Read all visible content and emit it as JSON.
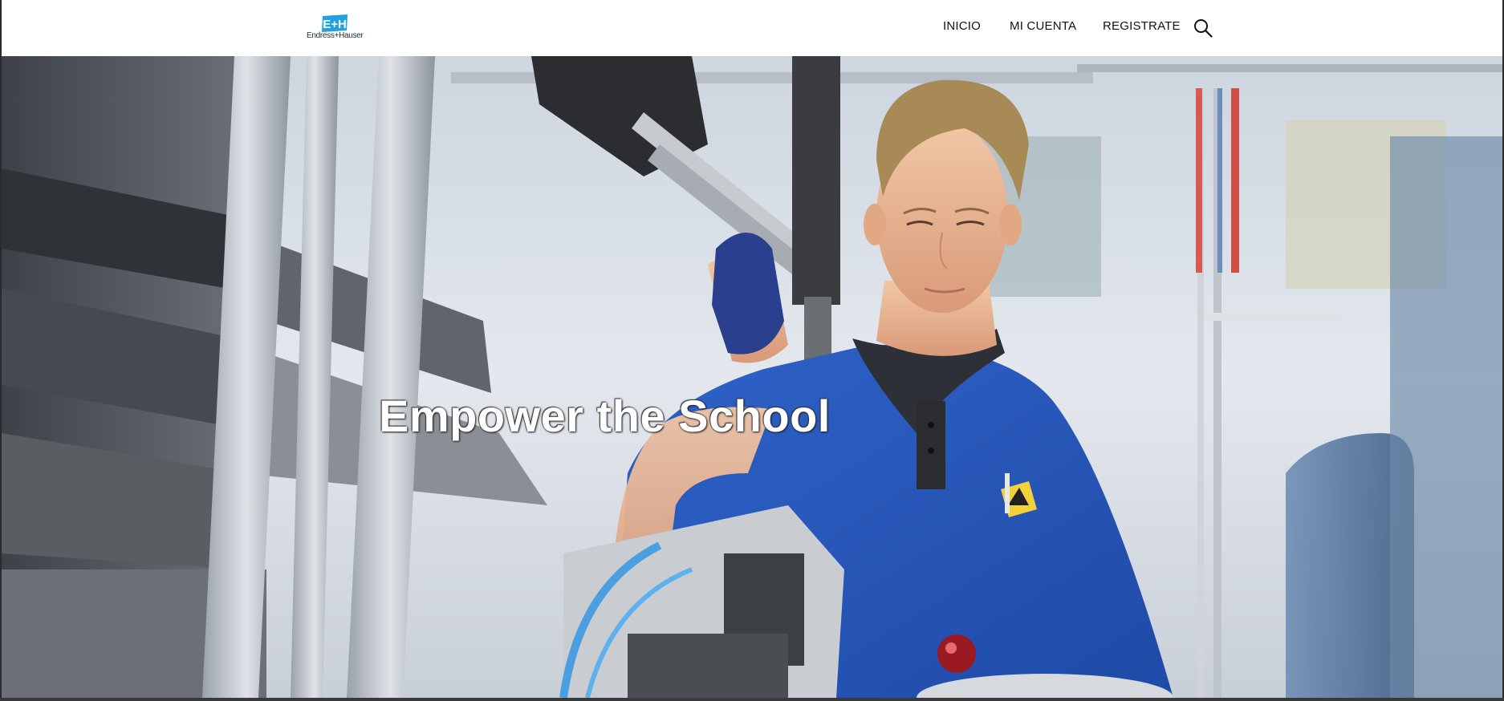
{
  "brand": {
    "logo_text": "Endress+Hauser",
    "logo_mark_text": "E+H",
    "color": "#1ea3e0"
  },
  "nav": {
    "items": [
      {
        "label": "INICIO"
      },
      {
        "label": "MI CUENTA"
      },
      {
        "label": "REGISTRATE"
      }
    ],
    "search_icon": "search-icon"
  },
  "hero": {
    "title": "Empower the School",
    "image": "factory-worker-blue-polo-photo"
  },
  "colors": {
    "header_bg": "#ffffff",
    "nav_text": "#111111",
    "shirt_blue": "#2b5fc4"
  }
}
